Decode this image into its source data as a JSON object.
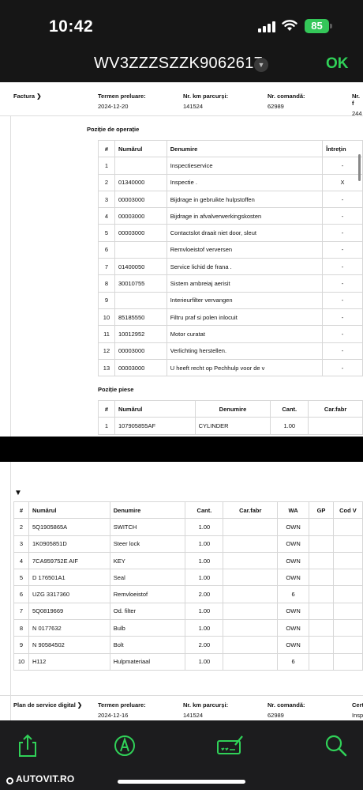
{
  "status_bar": {
    "time": "10:42",
    "battery": "85"
  },
  "header": {
    "vin": "WV3ZZZSZZK9062617",
    "ok_label": "OK"
  },
  "doc1": {
    "title": "Factura",
    "termen_label": "Termen preluare:",
    "termen_value": "2024-12-20",
    "km_label": "Nr. km parcurși:",
    "km_value": "141524",
    "comanda_label": "Nr. comandă:",
    "comanda_value": "62989",
    "extra_label": "Nr. f",
    "extra_value": "244",
    "operatii_title": "Poziție de operație",
    "operatii_headers": [
      "#",
      "Numărul",
      "Denumire",
      "Întrețin"
    ],
    "operatii_rows": [
      [
        "1",
        "",
        "Inspectieservice",
        "-"
      ],
      [
        "2",
        "01340000",
        "Inspectie .",
        "X"
      ],
      [
        "3",
        "00003000",
        "Bijdrage in gebruikte hulpstoffen",
        "-"
      ],
      [
        "4",
        "00003000",
        "Bijdrage in afvalverwerkingskosten",
        "-"
      ],
      [
        "5",
        "00003000",
        "Contactslot draait niet door, sleut",
        "-"
      ],
      [
        "6",
        "",
        "Remvloeistof verversen",
        "-"
      ],
      [
        "7",
        "01400050",
        "Service lichid de frana .",
        "-"
      ],
      [
        "8",
        "30010755",
        "Sistem ambreiaj aerisit",
        "-"
      ],
      [
        "9",
        "",
        "Interieurfilter vervangen",
        "-"
      ],
      [
        "10",
        "85185550",
        "Filtru praf si polen inlocuit",
        "-"
      ],
      [
        "11",
        "10012952",
        "Motor curatat",
        "-"
      ],
      [
        "12",
        "00003000",
        "Verlichting herstellen.",
        "-"
      ],
      [
        "13",
        "00003000",
        "U heeft recht op Pechhulp voor de v",
        "-"
      ]
    ],
    "piese_title": "Poziție piese",
    "piese_headers": [
      "#",
      "Numărul",
      "Denumire",
      "Cant.",
      "Car.fabr"
    ],
    "piese_rows": [
      [
        "1",
        "107905855AF",
        "CYLINDER",
        "1.00",
        ""
      ]
    ]
  },
  "doc2": {
    "headers": [
      "#",
      "Numărul",
      "Denumire",
      "Cant.",
      "Car.fabr",
      "WA",
      "GP",
      "Cod V"
    ],
    "rows": [
      [
        "2",
        "5Q1905865A",
        "SWITCH",
        "1.00",
        "",
        "OWN",
        "",
        ""
      ],
      [
        "3",
        "1K0905851D",
        "Steer lock",
        "1.00",
        "",
        "OWN",
        "",
        ""
      ],
      [
        "4",
        "7CA959752E AIF",
        "KEY",
        "1.00",
        "",
        "OWN",
        "",
        ""
      ],
      [
        "5",
        "D 176501A1",
        "Seal",
        "1.00",
        "",
        "OWN",
        "",
        ""
      ],
      [
        "6",
        "UZG 3317360",
        "Remvloeistof",
        "2.00",
        "",
        "6",
        "",
        ""
      ],
      [
        "7",
        "5Q0819669",
        "Od. filter",
        "1.00",
        "",
        "OWN",
        "",
        ""
      ],
      [
        "8",
        "N 0177632",
        "Bulb",
        "1.00",
        "",
        "OWN",
        "",
        ""
      ],
      [
        "9",
        "N 90584502",
        "Bolt",
        "2.00",
        "",
        "OWN",
        "",
        ""
      ],
      [
        "10",
        "H112",
        "Hulpmateriaal",
        "1.00",
        "",
        "6",
        "",
        ""
      ]
    ],
    "footer": {
      "title": "Plan de service digital",
      "termen_label": "Termen preluare:",
      "termen_value": "2024-12-16",
      "km_label": "Nr. km parcurși:",
      "km_value": "141524",
      "comanda_label": "Nr. comandă:",
      "comanda_value": "62989",
      "extra_label": "Cert",
      "extra_value": "Insp"
    }
  },
  "toolbar": {
    "icons": [
      "share-icon",
      "markup-icon",
      "signature-icon",
      "search-icon"
    ]
  },
  "watermark": "AUTOVIT.RO",
  "colors": {
    "accent_green": "#30d158",
    "toolbar_icon": "#30d158"
  }
}
